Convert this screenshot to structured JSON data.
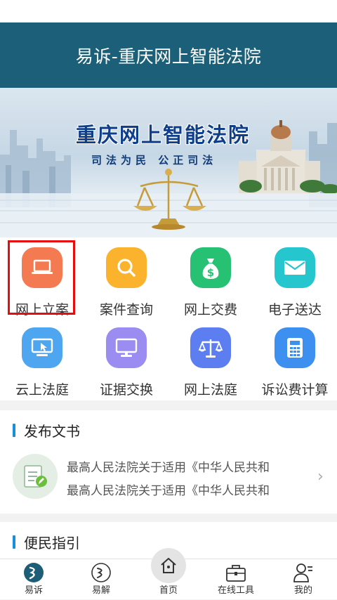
{
  "app": {
    "title": "易诉-重庆网上智能法院"
  },
  "banner": {
    "title": "重庆网上智能法院",
    "slogan": "司法为民  公正司法"
  },
  "grid": {
    "items": [
      {
        "label": "网上立案",
        "icon": "laptop-icon",
        "color": "#f47b51"
      },
      {
        "label": "案件查询",
        "icon": "search-icon",
        "color": "#fbb22c"
      },
      {
        "label": "网上交费",
        "icon": "money-bag-icon",
        "color": "#27c173"
      },
      {
        "label": "电子送达",
        "icon": "mail-icon",
        "color": "#26c6cf"
      },
      {
        "label": "云上法庭",
        "icon": "monitor-cursor-icon",
        "color": "#4ea6f0"
      },
      {
        "label": "证据交换",
        "icon": "monitor-icon",
        "color": "#9a8cf0"
      },
      {
        "label": "网上法庭",
        "icon": "scales-icon",
        "color": "#5c7ef0"
      },
      {
        "label": "诉讼费计算",
        "icon": "calculator-icon",
        "color": "#3d8ff0"
      }
    ]
  },
  "documents": {
    "title": "发布文书",
    "items": [
      "最高人民法院关于适用《中华人民共和",
      "最高人民法院关于适用《中华人民共和"
    ]
  },
  "guide": {
    "title": "便民指引"
  },
  "tabbar": {
    "tabs": [
      {
        "label": "易诉"
      },
      {
        "label": "易解"
      },
      {
        "label": "首页"
      },
      {
        "label": "在线工具"
      },
      {
        "label": "我的"
      }
    ]
  },
  "colors": {
    "titlebar": "#1b5f78",
    "accent": "#1a8fd8",
    "highlight": "#e50d0d"
  }
}
